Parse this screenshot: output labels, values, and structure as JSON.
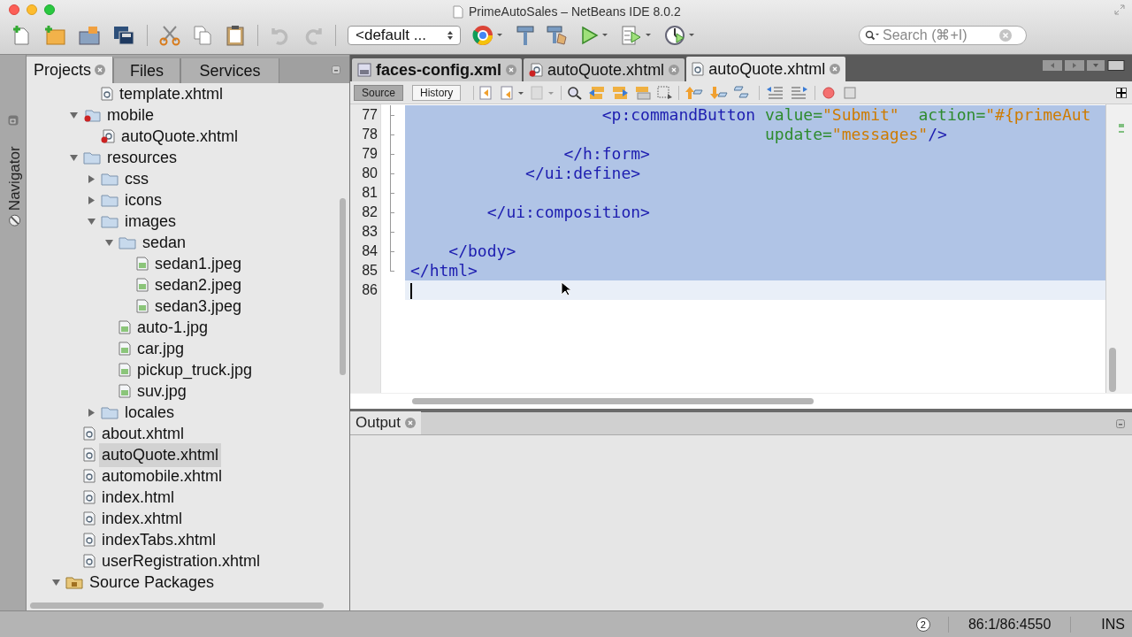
{
  "window": {
    "title": "PrimeAutoSales – NetBeans IDE 8.0.2"
  },
  "toolbar": {
    "config_select": "<default ...",
    "search": {
      "placeholder": "Search (⌘+I)"
    }
  },
  "side_strip": {
    "label": "Navigator"
  },
  "projects_panel": {
    "tabs": [
      {
        "label": "Projects",
        "selected": true,
        "closable": true
      },
      {
        "label": "Files",
        "selected": false,
        "closable": false
      },
      {
        "label": "Services",
        "selected": false,
        "closable": false
      }
    ],
    "tree": [
      {
        "kind": "hidden",
        "children": [
          {
            "kind": "hidden",
            "children": [
              {
                "label": "template.xhtml",
                "kind": "page",
                "selected": false
              }
            ]
          },
          {
            "label": "mobile",
            "kind": "error-folder",
            "expanded": true,
            "selected": false,
            "children": [
              {
                "label": "autoQuote.xhtml",
                "kind": "error-page",
                "selected": false
              }
            ]
          },
          {
            "label": "resources",
            "kind": "folder",
            "expanded": true,
            "selected": false,
            "children": [
              {
                "label": "css",
                "kind": "folder",
                "expanded": false,
                "selected": false
              },
              {
                "label": "icons",
                "kind": "folder",
                "expanded": false,
                "selected": false
              },
              {
                "label": "images",
                "kind": "folder",
                "expanded": true,
                "selected": false,
                "children": [
                  {
                    "label": "sedan",
                    "kind": "folder",
                    "expanded": true,
                    "selected": false,
                    "children": [
                      {
                        "label": "sedan1.jpeg",
                        "kind": "image",
                        "selected": false
                      },
                      {
                        "label": "sedan2.jpeg",
                        "kind": "image",
                        "selected": false
                      },
                      {
                        "label": "sedan3.jpeg",
                        "kind": "image",
                        "selected": false
                      }
                    ]
                  },
                  {
                    "label": "auto-1.jpg",
                    "kind": "image",
                    "selected": false
                  },
                  {
                    "label": "car.jpg",
                    "kind": "image",
                    "selected": false
                  },
                  {
                    "label": "pickup_truck.jpg",
                    "kind": "image",
                    "selected": false
                  },
                  {
                    "label": "suv.jpg",
                    "kind": "image",
                    "selected": false
                  }
                ]
              },
              {
                "label": "locales",
                "kind": "folder",
                "expanded": false,
                "selected": false
              }
            ]
          },
          {
            "label": "about.xhtml",
            "kind": "page",
            "selected": false
          },
          {
            "label": "autoQuote.xhtml",
            "kind": "page",
            "selected": true
          },
          {
            "label": "automobile.xhtml",
            "kind": "page",
            "selected": false
          },
          {
            "label": "index.html",
            "kind": "page",
            "selected": false
          },
          {
            "label": "index.xhtml",
            "kind": "page",
            "selected": false
          },
          {
            "label": "indexTabs.xhtml",
            "kind": "page",
            "selected": false
          },
          {
            "label": "userRegistration.xhtml",
            "kind": "page",
            "selected": false
          }
        ]
      },
      {
        "label": "Source Packages",
        "kind": "package-folder",
        "expanded": true,
        "selected": false
      }
    ]
  },
  "editor": {
    "tabs": [
      {
        "label": "faces-config.xml",
        "kind": "jsf",
        "modified": true,
        "selected": false
      },
      {
        "label": "autoQuote.xhtml",
        "kind": "error-page",
        "modified": false,
        "selected": false
      },
      {
        "label": "autoQuote.xhtml",
        "kind": "page",
        "modified": false,
        "selected": true
      }
    ],
    "view_buttons": [
      {
        "label": "Source",
        "selected": true
      },
      {
        "label": "History",
        "selected": false
      }
    ],
    "lines": [
      {
        "number": "77",
        "selected": true,
        "current": false,
        "tokens": [
          {
            "kind": "tag",
            "text": "                    <p:commandButton"
          },
          {
            "kind": "attr",
            "text": " value="
          },
          {
            "kind": "value",
            "text": "\"Submit\""
          },
          {
            "kind": "attr",
            "text": "  action="
          },
          {
            "kind": "value",
            "text": "\"#{primeAut"
          }
        ]
      },
      {
        "number": "78",
        "selected": true,
        "current": false,
        "tokens": [
          {
            "kind": "attr",
            "text": "                                     update="
          },
          {
            "kind": "value",
            "text": "\"messages\""
          },
          {
            "kind": "tag",
            "text": "/>"
          }
        ]
      },
      {
        "number": "79",
        "selected": true,
        "current": false,
        "tokens": [
          {
            "kind": "tag",
            "text": "                </h:form>"
          }
        ]
      },
      {
        "number": "80",
        "selected": true,
        "current": false,
        "tokens": [
          {
            "kind": "tag",
            "text": "            </ui:define>"
          }
        ]
      },
      {
        "number": "81",
        "selected": true,
        "current": false
      },
      {
        "number": "82",
        "selected": true,
        "current": false,
        "tokens": [
          {
            "kind": "tag",
            "text": "        </ui:composition>"
          }
        ]
      },
      {
        "number": "83",
        "selected": true,
        "current": false
      },
      {
        "number": "84",
        "selected": true,
        "current": false,
        "tokens": [
          {
            "kind": "tag",
            "text": "    </body>"
          }
        ]
      },
      {
        "number": "85",
        "selected": true,
        "current": false,
        "tokens": [
          {
            "kind": "tag",
            "text": "</html>"
          }
        ]
      },
      {
        "number": "86",
        "selected": false,
        "current": true
      }
    ]
  },
  "output_panel": {
    "tab": "Output"
  },
  "status_bar": {
    "notifications": "2",
    "position": "86:1/86:4550",
    "mode": "INS"
  }
}
